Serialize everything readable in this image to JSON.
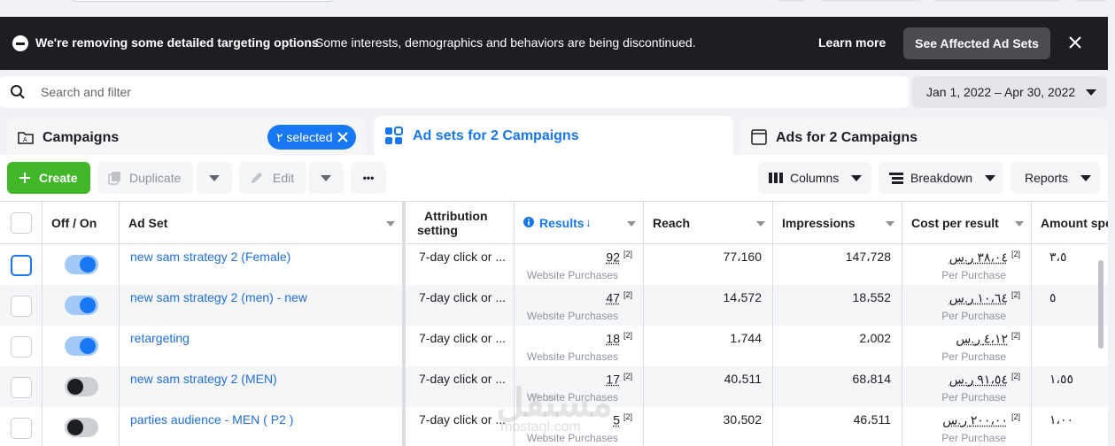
{
  "banner": {
    "title": "We're removing some detailed targeting options",
    "text": "Some interests, demographics and behaviors are being discontinued.",
    "learn_more": "Learn more",
    "button": "See Affected Ad Sets"
  },
  "search": {
    "placeholder": "Search and filter"
  },
  "date_range": "Jan 1, 2022 – Apr 30, 2022",
  "tabs": [
    {
      "label": "Campaigns",
      "icon": "folder-icon"
    },
    {
      "label": "Ad sets for 2 Campaigns",
      "icon": "grid-icon"
    },
    {
      "label": "Ads for 2 Campaigns",
      "icon": "ad-icon"
    }
  ],
  "selected_pill": "٢ selected",
  "toolbar": {
    "create": "Create",
    "duplicate": "Duplicate",
    "edit": "Edit",
    "more": "•••",
    "columns": "Columns",
    "breakdown": "Breakdown",
    "reports": "Reports"
  },
  "columns": {
    "off_on": "Off / On",
    "ad_set": "Ad Set",
    "attribution_line1": "Attribution",
    "attribution_line2": "setting",
    "results": "Results",
    "reach": "Reach",
    "impressions": "Impressions",
    "cost_per_result": "Cost per result",
    "amount_spent": "Amount spe"
  },
  "rows": [
    {
      "name": "new sam strategy 2 (Female)",
      "on": true,
      "attribution": "7-day click or ...",
      "results": "92",
      "results_note": "[2]",
      "results_sub": "Website Purchases",
      "reach": "77،160",
      "impressions": "147،728",
      "cost": "٣٨،٠٤ ر.س",
      "cost_note": "[2]",
      "cost_sub": "Per Purchase",
      "amount": "٣،٥"
    },
    {
      "name": "new sam strategy 2 (men) - new",
      "on": true,
      "attribution": "7-day click or ...",
      "results": "47",
      "results_note": "[2]",
      "results_sub": "Website Purchases",
      "reach": "14،572",
      "impressions": "18،552",
      "cost": "١٠،٦٤ ر.س",
      "cost_note": "[2]",
      "cost_sub": "Per Purchase",
      "amount": "٥"
    },
    {
      "name": "retargeting",
      "on": true,
      "attribution": "7-day click or ...",
      "results": "18",
      "results_note": "[2]",
      "results_sub": "Website Purchases",
      "reach": "1،744",
      "impressions": "2،002",
      "cost": "٤،١٢ ر.س",
      "cost_note": "[2]",
      "cost_sub": "Per Purchase",
      "amount": ""
    },
    {
      "name": "new sam strategy 2 (MEN)",
      "on": false,
      "attribution": "7-day click or ...",
      "results": "17",
      "results_note": "[2]",
      "results_sub": "Website Purchases",
      "reach": "40،511",
      "impressions": "68،814",
      "cost": "٩١،٥٤ ر.س",
      "cost_note": "[2]",
      "cost_sub": "Per Purchase",
      "amount": "١،٥٥"
    },
    {
      "name": "parties audience - MEN ( P2 )",
      "on": false,
      "attribution": "7-day click or ...",
      "results": "5",
      "results_note": "[2]",
      "results_sub": "Website Purchases",
      "reach": "30،502",
      "impressions": "46،511",
      "cost": "٢٠٠،٠٠ ر.س",
      "cost_note": "[2]",
      "cost_sub": "Per Purchase",
      "amount": "١،٠٠"
    }
  ],
  "watermark": "مستقل",
  "watermark_sub": "mostaql.com"
}
